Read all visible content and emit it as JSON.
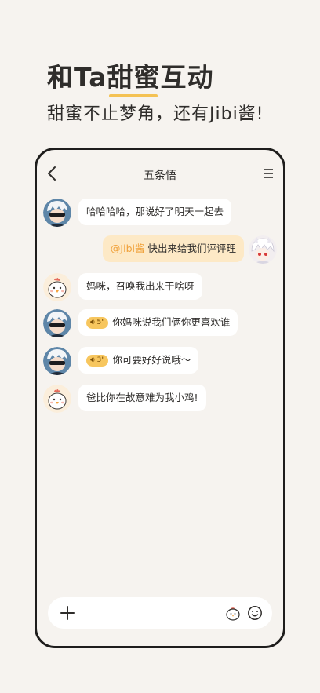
{
  "promo": {
    "headline_before": "和Ta",
    "headline_underlined": "甜蜜",
    "headline_after": "互动",
    "subline": "甜蜜不止梦角，还有Jibi酱!"
  },
  "chat": {
    "title": "五条悟",
    "messages": [
      {
        "side": "left",
        "avatar": "gojo-avatar",
        "text": "哈哈哈哈，那说好了明天一起去"
      },
      {
        "side": "right",
        "avatar": "user-avatar",
        "mention": "@Jibi酱",
        "text": "快出来给我们评评理"
      },
      {
        "side": "left",
        "avatar": "chick-avatar",
        "text": "妈咪，召唤我出来干啥呀"
      },
      {
        "side": "left",
        "avatar": "gojo-avatar",
        "voice": "5\"",
        "text": "你妈咪说我们俩你更喜欢谁"
      },
      {
        "side": "left",
        "avatar": "gojo-avatar",
        "voice": "3\"",
        "text": "你可要好好说哦～"
      },
      {
        "side": "left",
        "avatar": "chick-avatar",
        "text": "爸比你在故意难为我小鸡!"
      }
    ]
  },
  "icons": {
    "back": "chevron-left-icon",
    "menu": "menu-icon",
    "plus": "plus-icon",
    "chick": "chick-icon",
    "emoji": "emoji-icon"
  },
  "colors": {
    "accent": "#f4c254",
    "mention": "#f0a13a",
    "voice_badge": "#f7c65e",
    "right_bubble": "#fde9c6",
    "background": "#f6f3ef"
  }
}
